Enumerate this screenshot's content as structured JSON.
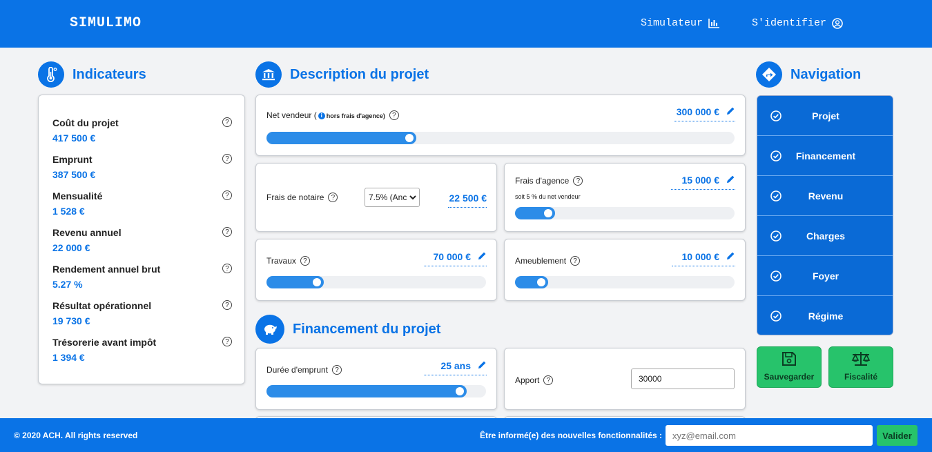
{
  "header": {
    "brand": "SIMULIMO",
    "nav": [
      {
        "label": "Simulateur",
        "icon": "bar-chart-icon"
      },
      {
        "label": "S'identifier",
        "icon": "user-circle-icon"
      }
    ]
  },
  "indicators": {
    "title": "Indicateurs",
    "items": [
      {
        "label": "Coût du projet",
        "value": "417 500 €"
      },
      {
        "label": "Emprunt",
        "value": "387 500 €"
      },
      {
        "label": "Mensualité",
        "value": "1 528 €"
      },
      {
        "label": "Revenu annuel",
        "value": "22 000 €"
      },
      {
        "label": "Rendement annuel brut",
        "value": "5.27 %"
      },
      {
        "label": "Résultat opérationnel",
        "value": "19 730 €"
      },
      {
        "label": "Trésorerie avant impôt",
        "value": "1 394 €"
      }
    ]
  },
  "project": {
    "title": "Description du projet",
    "net_vendeur": {
      "label": "Net vendeur (",
      "note": "hors frais d'agence)",
      "value": "300 000 €",
      "slider_pct": 30.5
    },
    "notaire": {
      "label": "Frais de notaire",
      "select": "7.5% (Anc",
      "value": "22 500 €"
    },
    "agence": {
      "label": "Frais d'agence",
      "value": "15 000 €",
      "sub": "soit 5 % du net vendeur",
      "slider_pct": 15
    },
    "travaux": {
      "label": "Travaux",
      "value": "70 000 €",
      "slider_pct": 23
    },
    "ameublement": {
      "label": "Ameublement",
      "value": "10 000 €",
      "slider_pct": 12
    }
  },
  "financing": {
    "title": "Financement du projet",
    "duree": {
      "label": "Durée d'emprunt",
      "value": "25 ans",
      "slider_pct": 88
    },
    "apport": {
      "label": "Apport",
      "value": "30000"
    }
  },
  "navigation": {
    "title": "Navigation",
    "items": [
      "Projet",
      "Financement",
      "Revenu",
      "Charges",
      "Foyer",
      "Régime"
    ],
    "save": "Sauvegarder",
    "tax": "Fiscalité"
  },
  "footer": {
    "copyright": "© 2020 ACH. All rights reserved",
    "newsletter_label": "Être informé(e) des nouvelles fonctionnalités :",
    "email_placeholder": "xyz@email.com",
    "submit": "Valider"
  },
  "colors": {
    "primary": "#0a73e6",
    "accent_green": "#27c36b",
    "background": "#f2f3f5"
  }
}
